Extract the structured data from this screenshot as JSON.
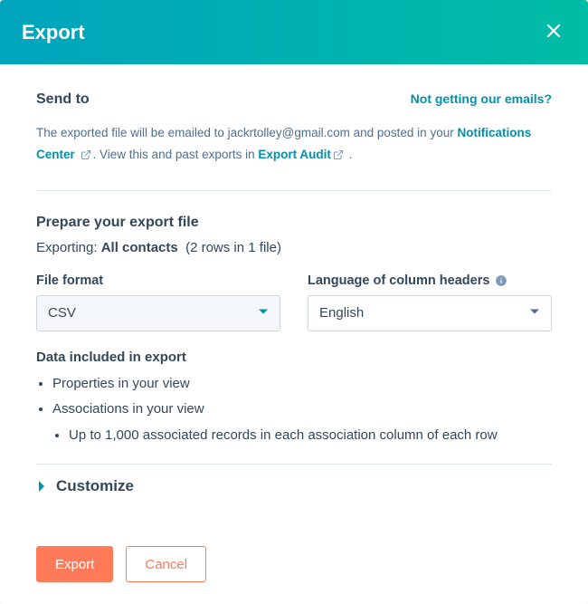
{
  "header": {
    "title": "Export"
  },
  "send": {
    "label": "Send to",
    "helpLink": "Not getting our emails?",
    "desc_prefix": "The exported file will be emailed to ",
    "email": "jackrtolley@gmail.com",
    "desc_mid": " and posted in your ",
    "notifications_link": "Notifications Center",
    "desc_after_notifications": ". View this and past exports in ",
    "export_audit_link": "Export Audit",
    "desc_suffix": "."
  },
  "prepare": {
    "title": "Prepare your export file",
    "exporting_label": "Exporting: ",
    "exporting_target": "All contacts",
    "exporting_meta": "(2 rows in 1 file)"
  },
  "form": {
    "file_format_label": "File format",
    "file_format_value": "CSV",
    "language_label": "Language of column headers",
    "language_value": "English"
  },
  "data_included": {
    "title": "Data included in export",
    "items": [
      "Properties in your view",
      "Associations in your view"
    ],
    "subitem": "Up to 1,000 associated records in each association column of each row"
  },
  "customize": {
    "label": "Customize"
  },
  "actions": {
    "export": "Export",
    "cancel": "Cancel"
  }
}
